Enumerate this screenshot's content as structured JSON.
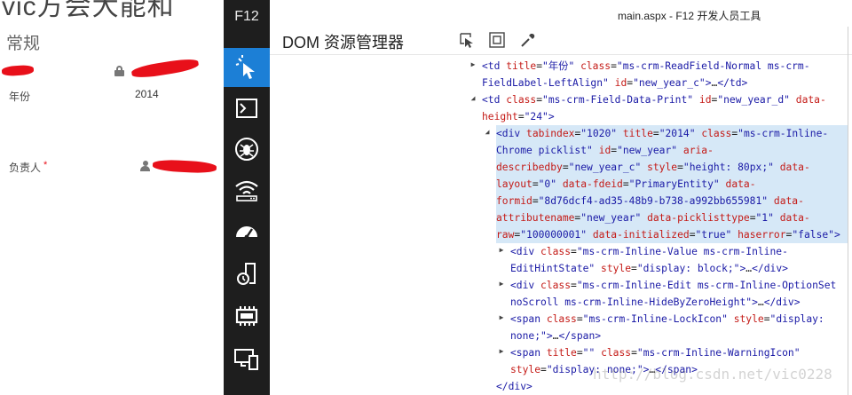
{
  "crm": {
    "title": "vic方会大能和",
    "section": "常规",
    "fields": [
      {
        "label": "年份",
        "value": "2014",
        "icon": "lock-icon"
      },
      {
        "label": "负责人",
        "required": "*",
        "icon": "user-icon"
      }
    ]
  },
  "devtools": {
    "f12_label": "F12",
    "window_title": "main.aspx - F12 开发人员工具",
    "panel_title": "DOM 资源管理器",
    "tools": [
      {
        "icon": "dom-explorer-icon",
        "active": true
      },
      {
        "icon": "console-icon"
      },
      {
        "icon": "debugger-icon"
      },
      {
        "icon": "network-icon"
      },
      {
        "icon": "ui-responsiveness-icon"
      },
      {
        "icon": "profiler-icon"
      },
      {
        "icon": "memory-icon"
      },
      {
        "icon": "emulation-icon"
      }
    ],
    "header_buttons": [
      "select-element-icon",
      "highlight-icon",
      "color-picker-icon"
    ],
    "accent_color": "#1c7fd6",
    "selected_color": "#d6e8f7"
  },
  "dom_tree": [
    {
      "arrow": "right",
      "lines": [
        [
          [
            "t",
            "<td "
          ],
          [
            "a",
            "title"
          ],
          [
            "x",
            "="
          ],
          [
            "v",
            "\"年份\""
          ],
          [
            "x",
            " "
          ],
          [
            "a",
            "class"
          ],
          [
            "x",
            "="
          ],
          [
            "v",
            "\"ms-crm-ReadField-Normal ms-crm-"
          ]
        ],
        [
          [
            "v",
            "FieldLabel-LeftAlign\""
          ],
          [
            "x",
            " "
          ],
          [
            "a",
            "id"
          ],
          [
            "x",
            "="
          ],
          [
            "v",
            "\"new_year_c\""
          ],
          [
            "t",
            ">"
          ],
          [
            "x",
            "…"
          ],
          [
            "t",
            "</td>"
          ]
        ]
      ]
    },
    {
      "arrow": "down",
      "lines": [
        [
          [
            "t",
            "<td "
          ],
          [
            "a",
            "class"
          ],
          [
            "x",
            "="
          ],
          [
            "v",
            "\"ms-crm-Field-Data-Print\""
          ],
          [
            "x",
            " "
          ],
          [
            "a",
            "id"
          ],
          [
            "x",
            "="
          ],
          [
            "v",
            "\"new_year_d\""
          ],
          [
            "x",
            " "
          ],
          [
            "a",
            "data-"
          ]
        ],
        [
          [
            "a",
            "height"
          ],
          [
            "x",
            "="
          ],
          [
            "v",
            "\"24\""
          ],
          [
            "t",
            ">"
          ]
        ]
      ]
    },
    {
      "arrow": "down",
      "selected": true,
      "lines": [
        [
          [
            "t",
            "<div "
          ],
          [
            "a",
            "tabindex"
          ],
          [
            "x",
            "="
          ],
          [
            "v",
            "\"1020\""
          ],
          [
            "x",
            " "
          ],
          [
            "a",
            "title"
          ],
          [
            "x",
            "="
          ],
          [
            "v",
            "\"2014\""
          ],
          [
            "x",
            " "
          ],
          [
            "a",
            "class"
          ],
          [
            "x",
            "="
          ],
          [
            "v",
            "\"ms-crm-Inline-"
          ]
        ],
        [
          [
            "v",
            "Chrome picklist\""
          ],
          [
            "x",
            " "
          ],
          [
            "a",
            "id"
          ],
          [
            "x",
            "="
          ],
          [
            "v",
            "\"new_year\""
          ],
          [
            "x",
            " "
          ],
          [
            "a",
            "aria-"
          ]
        ],
        [
          [
            "a",
            "describedby"
          ],
          [
            "x",
            "="
          ],
          [
            "v",
            "\"new_year_c\""
          ],
          [
            "x",
            " "
          ],
          [
            "a",
            "style"
          ],
          [
            "x",
            "="
          ],
          [
            "v",
            "\"height: 80px;\""
          ],
          [
            "x",
            " "
          ],
          [
            "a",
            "data-"
          ]
        ],
        [
          [
            "a",
            "layout"
          ],
          [
            "x",
            "="
          ],
          [
            "v",
            "\"0\""
          ],
          [
            "x",
            " "
          ],
          [
            "a",
            "data-fdeid"
          ],
          [
            "x",
            "="
          ],
          [
            "v",
            "\"PrimaryEntity\""
          ],
          [
            "x",
            " "
          ],
          [
            "a",
            "data-"
          ]
        ],
        [
          [
            "a",
            "formid"
          ],
          [
            "x",
            "="
          ],
          [
            "v",
            "\"8d76dcf4-ad35-48b9-b738-a992bb655981\""
          ],
          [
            "x",
            " "
          ],
          [
            "a",
            "data-"
          ]
        ],
        [
          [
            "a",
            "attributename"
          ],
          [
            "x",
            "="
          ],
          [
            "v",
            "\"new_year\""
          ],
          [
            "x",
            " "
          ],
          [
            "a",
            "data-picklisttype"
          ],
          [
            "x",
            "="
          ],
          [
            "v",
            "\"1\""
          ],
          [
            "x",
            " "
          ],
          [
            "a",
            "data-"
          ]
        ],
        [
          [
            "a",
            "raw"
          ],
          [
            "x",
            "="
          ],
          [
            "v",
            "\"100000001\""
          ],
          [
            "x",
            " "
          ],
          [
            "a",
            "data-initialized"
          ],
          [
            "x",
            "="
          ],
          [
            "v",
            "\"true\""
          ],
          [
            "x",
            " "
          ],
          [
            "a",
            "haserror"
          ],
          [
            "x",
            "="
          ],
          [
            "v",
            "\"false\""
          ],
          [
            "t",
            ">"
          ]
        ]
      ]
    },
    {
      "arrow": "right",
      "lines": [
        [
          [
            "t",
            "<div "
          ],
          [
            "a",
            "class"
          ],
          [
            "x",
            "="
          ],
          [
            "v",
            "\"ms-crm-Inline-Value ms-crm-Inline-"
          ]
        ],
        [
          [
            "v",
            "EditHintState\""
          ],
          [
            "x",
            " "
          ],
          [
            "a",
            "style"
          ],
          [
            "x",
            "="
          ],
          [
            "v",
            "\"display: block;\""
          ],
          [
            "t",
            ">"
          ],
          [
            "x",
            "…"
          ],
          [
            "t",
            "</div>"
          ]
        ]
      ]
    },
    {
      "arrow": "right",
      "lines": [
        [
          [
            "t",
            "<div "
          ],
          [
            "a",
            "class"
          ],
          [
            "x",
            "="
          ],
          [
            "v",
            "\"ms-crm-Inline-Edit ms-crm-Inline-OptionSet"
          ]
        ],
        [
          [
            "v",
            "noScroll ms-crm-Inline-HideByZeroHeight\""
          ],
          [
            "t",
            ">"
          ],
          [
            "x",
            "…"
          ],
          [
            "t",
            "</div>"
          ]
        ]
      ]
    },
    {
      "arrow": "right",
      "lines": [
        [
          [
            "t",
            "<span "
          ],
          [
            "a",
            "class"
          ],
          [
            "x",
            "="
          ],
          [
            "v",
            "\"ms-crm-Inline-LockIcon\""
          ],
          [
            "x",
            " "
          ],
          [
            "a",
            "style"
          ],
          [
            "x",
            "="
          ],
          [
            "v",
            "\"display:"
          ]
        ],
        [
          [
            "v",
            "none;\""
          ],
          [
            "t",
            ">"
          ],
          [
            "x",
            "…"
          ],
          [
            "t",
            "</span>"
          ]
        ]
      ]
    },
    {
      "arrow": "right",
      "lines": [
        [
          [
            "t",
            "<span "
          ],
          [
            "a",
            "title"
          ],
          [
            "x",
            "="
          ],
          [
            "v",
            "\"\""
          ],
          [
            "x",
            " "
          ],
          [
            "a",
            "class"
          ],
          [
            "x",
            "="
          ],
          [
            "v",
            "\"ms-crm-Inline-WarningIcon\""
          ]
        ],
        [
          [
            "a",
            "style"
          ],
          [
            "x",
            "="
          ],
          [
            "v",
            "\"display: none;\""
          ],
          [
            "t",
            ">"
          ],
          [
            "x",
            "…"
          ],
          [
            "t",
            "</span>"
          ]
        ]
      ]
    },
    {
      "arrow": "none",
      "lines": [
        [
          [
            "t",
            "</div>"
          ]
        ]
      ]
    }
  ],
  "watermark": "http://blog.csdn.net/vic0228"
}
